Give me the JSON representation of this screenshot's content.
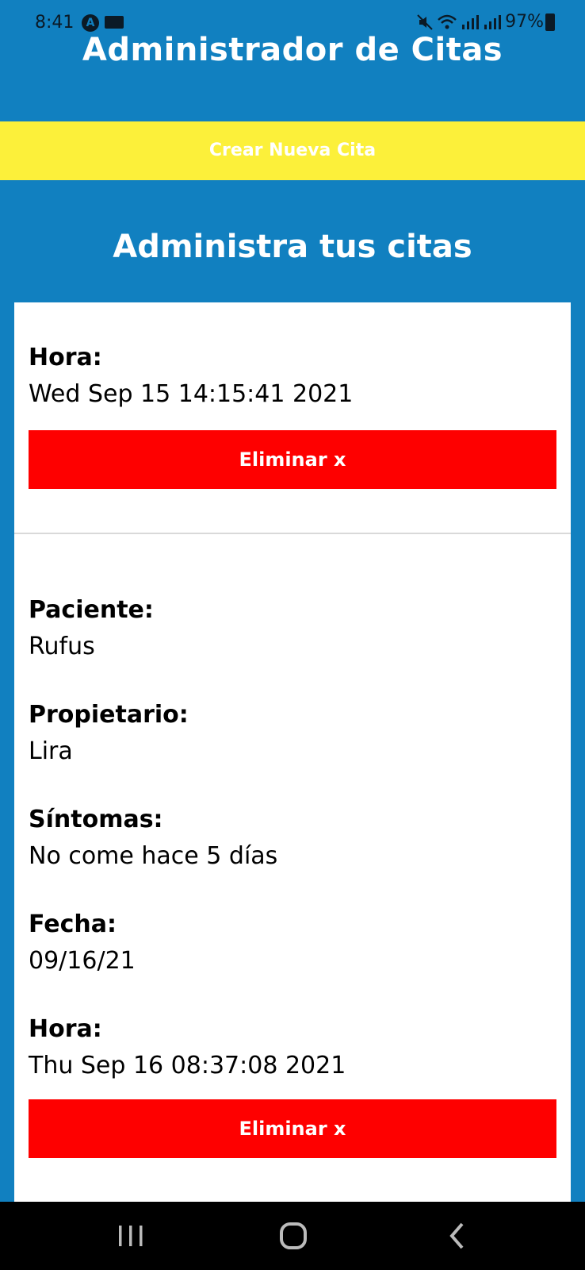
{
  "status_bar": {
    "time": "8:41",
    "battery": "97%"
  },
  "app": {
    "title": "Administrador de Citas",
    "create_button": "Crear Nueva Cita",
    "subtitle": "Administra tus citas"
  },
  "appointments": [
    {
      "hora_label": "Hora:",
      "hora": "Wed Sep 15 14:15:41 2021",
      "delete_label": "Eliminar x"
    },
    {
      "paciente_label": "Paciente:",
      "paciente": "Rufus",
      "propietario_label": "Propietario:",
      "propietario": "Lira",
      "sintomas_label": "Síntomas:",
      "sintomas": "No come hace 5 días",
      "fecha_label": "Fecha:",
      "fecha": "09/16/21",
      "hora_label": "Hora:",
      "hora": "Thu Sep 16 08:37:08 2021",
      "delete_label": "Eliminar x"
    }
  ],
  "colors": {
    "background": "#1180c0",
    "create_button": "#fcf03a",
    "delete_button": "#fe0000",
    "card": "#ffffff"
  },
  "nav": {
    "icons": [
      "recent-apps-icon",
      "home-icon",
      "back-icon"
    ]
  }
}
